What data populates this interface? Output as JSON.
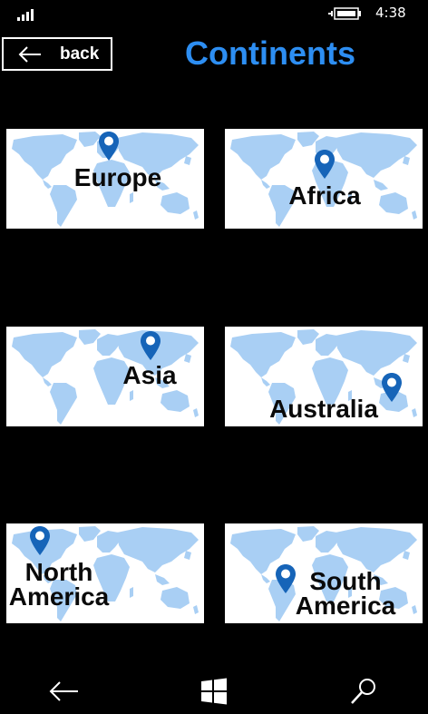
{
  "status": {
    "time": "4:38"
  },
  "header": {
    "back_label": "back",
    "title": "Continents"
  },
  "tiles": [
    {
      "label": "Europe"
    },
    {
      "label": "Africa"
    },
    {
      "label": "Asia"
    },
    {
      "label": "Australia"
    },
    {
      "label_lines": [
        "North",
        "America"
      ]
    },
    {
      "label_lines": [
        "South",
        "America"
      ]
    }
  ],
  "colors": {
    "title": "#2d8ef2",
    "map_land": "#a9cff4",
    "pin": "#1664b8"
  },
  "icons": {
    "back": "arrow-left-icon",
    "signal": "signal-strength-icon",
    "battery": "battery-charging-icon",
    "nav_back": "arrow-left-icon",
    "nav_home": "windows-logo-icon",
    "nav_search": "search-icon"
  }
}
